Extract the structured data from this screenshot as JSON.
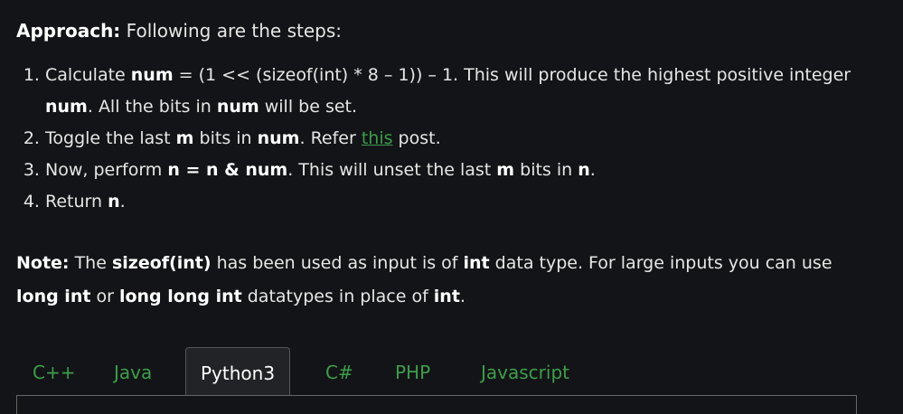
{
  "approach": {
    "heading": "Approach:",
    "text": " Following are the steps:"
  },
  "steps": [
    {
      "parts": [
        "Calculate ",
        "num",
        " = (1 << (sizeof(int) * 8 – 1)) – 1. This will produce the highest positive integer ",
        "num",
        ". All the bits in ",
        "num",
        " will be set."
      ]
    },
    {
      "parts": [
        "Toggle the last ",
        "m",
        " bits in ",
        "num",
        ". Refer ",
        "this",
        " post."
      ]
    },
    {
      "parts": [
        "Now, perform ",
        "n = n & num",
        ". This will unset the last ",
        "m",
        " bits in ",
        "n",
        "."
      ]
    },
    {
      "parts": [
        "Return ",
        "n",
        "."
      ]
    }
  ],
  "note": {
    "label": "Note:",
    "t1": " The ",
    "b1": "sizeof(int)",
    "t2": " has been used as input is of ",
    "b2": "int",
    "t3": " data type. For large inputs you can use ",
    "b3": "long int",
    "t4": " or ",
    "b4": "long long int",
    "t5": " datatypes in place of ",
    "b5": "int",
    "t6": "."
  },
  "tabs": [
    {
      "label": "C++",
      "active": false
    },
    {
      "label": "Java",
      "active": false
    },
    {
      "label": "Python3",
      "active": true
    },
    {
      "label": "C#",
      "active": false
    },
    {
      "label": "PHP",
      "active": false
    },
    {
      "label": "Javascript",
      "active": false
    }
  ],
  "colors": {
    "background": "#131417",
    "text": "#e6e6e6",
    "link": "#3d9d4b",
    "active_tab_bg": "#222326"
  }
}
